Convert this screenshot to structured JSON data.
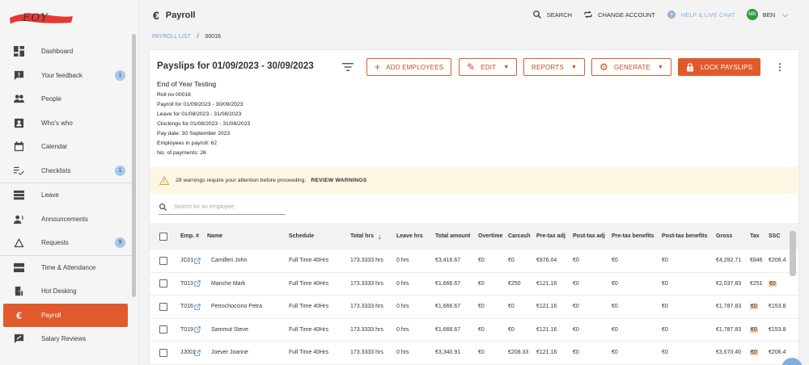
{
  "logo": {
    "text": "EOY"
  },
  "sidebar": {
    "items": [
      {
        "label": "Dashboard",
        "icon": "dashboard-icon"
      },
      {
        "label": "Your feedback",
        "icon": "feedback-icon",
        "badge": "1"
      },
      {
        "label": "People",
        "icon": "people-icon"
      },
      {
        "label": "Who's who",
        "icon": "contact-card-icon"
      },
      {
        "label": "Calendar",
        "icon": "calendar-icon"
      },
      {
        "label": "Checklists",
        "icon": "checklist-icon",
        "badge": "1"
      },
      {
        "label": "Leave",
        "icon": "leave-icon"
      },
      {
        "label": "Announcements",
        "icon": "announcement-icon"
      },
      {
        "label": "Requests",
        "icon": "requests-icon",
        "badge": "9"
      },
      {
        "label": "Time & Attendance",
        "icon": "clock-icon"
      },
      {
        "label": "Hot Desking",
        "icon": "desk-icon"
      },
      {
        "label": "Payroll",
        "icon": "euro-icon",
        "active": true
      },
      {
        "label": "Salary Reviews",
        "icon": "salary-review-icon"
      }
    ]
  },
  "header": {
    "title": "Payroll",
    "title_icon": "€",
    "search_label": "SEARCH",
    "change_account_label": "CHANGE ACCOUNT",
    "help_label": "HELP & LIVE CHAT",
    "user_initials": "MB",
    "user_name": "BEN"
  },
  "breadcrumb": {
    "link": "PAYROLL LIST",
    "separator": "/",
    "current": "00016"
  },
  "card": {
    "title": "Payslips for 01/09/2023 - 30/09/2023",
    "buttons": {
      "add_employees": "ADD EMPLOYEES",
      "edit": "EDIT",
      "reports": "REPORTS",
      "generate": "GENERATE",
      "lock_payslips": "LOCK PAYSLIPS"
    },
    "info": {
      "name": "End of Year Testing",
      "roll": "Roll no 00016",
      "payroll_for": "Payroll for 01/09/2023 - 30/09/2023",
      "leave_for": "Leave for 01/08/2023 - 31/08/2023",
      "clockings_for": "Clockings for 01/08/2023 - 31/08/2023",
      "pay_date": "Pay date: 30 September 2023",
      "employees": "Employees in payroll: 62",
      "payments": "No. of payments: 26"
    },
    "warning": {
      "text": "28 warnings require your attention before proceeding.",
      "action": "REVIEW WARNINGS",
      "color": "#fdf6e3"
    },
    "search_placeholder": "Search for an employee"
  },
  "table": {
    "headers": {
      "emp": "Emp. #",
      "name": "Name",
      "schedule": "Schedule",
      "total_hrs": "Total hrs",
      "leave_hrs": "Leave hrs",
      "total_amount": "Total amount",
      "overtime": "Overtime",
      "carcash": "Carcash",
      "pre_tax_adj": "Pre-tax adj",
      "post_tax_adj": "Post-tax adj",
      "pre_tax_benefits": "Pre-tax benefits",
      "post_tax_benefits": "Post-tax benefits",
      "gross": "Gross",
      "tax": "Tax",
      "ssc": "SSC"
    },
    "rows": [
      {
        "emp": "JC01",
        "name": "Camilleri John",
        "schedule": "Full Time 40Hrs",
        "total_hrs": "173.3333 hrs",
        "leave_hrs": "0 hrs",
        "total_amount": "€3,416.67",
        "overtime": "€0",
        "carcash": "€0",
        "pre_tax_adj": "€876.04",
        "post_tax_adj": "€0",
        "pre_tax_benefits": "€0",
        "post_tax_benefits": "€0",
        "gross": "€4,292.71",
        "tax": "€846",
        "tax_flag": false,
        "ssc": "€206.4",
        "ssc_flag": false
      },
      {
        "emp": "T013",
        "name": "Manche Mark",
        "schedule": "Full Time 40Hrs",
        "total_hrs": "173.3333 hrs",
        "leave_hrs": "0 hrs",
        "total_amount": "€1,666.67",
        "overtime": "€0",
        "carcash": "€250",
        "pre_tax_adj": "€121.16",
        "post_tax_adj": "€0",
        "pre_tax_benefits": "€0",
        "post_tax_benefits": "€0",
        "gross": "€2,037.83",
        "tax": "€251",
        "tax_flag": false,
        "ssc": "€0",
        "ssc_flag": true
      },
      {
        "emp": "T016",
        "name": "Petrochoccino Petra",
        "schedule": "Full Time 40Hrs",
        "total_hrs": "173.3333 hrs",
        "leave_hrs": "0 hrs",
        "total_amount": "€1,666.67",
        "overtime": "€0",
        "carcash": "€0",
        "pre_tax_adj": "€121.16",
        "post_tax_adj": "€0",
        "pre_tax_benefits": "€0",
        "post_tax_benefits": "€0",
        "gross": "€1,787.83",
        "tax": "€0",
        "tax_flag": true,
        "ssc": "€153.8",
        "ssc_flag": false
      },
      {
        "emp": "T019",
        "name": "Sammut Steve",
        "schedule": "Full Time 40Hrs",
        "total_hrs": "173.3333 hrs",
        "leave_hrs": "0 hrs",
        "total_amount": "€1,666.67",
        "overtime": "€0",
        "carcash": "€0",
        "pre_tax_adj": "€121.16",
        "post_tax_adj": "€0",
        "pre_tax_benefits": "€0",
        "post_tax_benefits": "€0",
        "gross": "€1,787.83",
        "tax": "€0",
        "tax_flag": true,
        "ssc": "€153.8",
        "ssc_flag": false
      },
      {
        "emp": "JJ001",
        "name": "Joever Joanne",
        "schedule": "Full Time 40Hrs",
        "total_hrs": "173.3333 hrs",
        "leave_hrs": "0 hrs",
        "total_amount": "€3,340.91",
        "overtime": "€0",
        "carcash": "€208.33",
        "pre_tax_adj": "€121.16",
        "post_tax_adj": "€0",
        "pre_tax_benefits": "€0",
        "post_tax_benefits": "€0",
        "gross": "€3,670.40",
        "tax": "€0",
        "tax_flag": true,
        "ssc": "€206.4",
        "ssc_flag": false
      }
    ]
  },
  "colors": {
    "accent": "#e15a2d",
    "badge": "#a7c8ea",
    "help": "#8fb2d6",
    "warning_bg": "#fdf6e3"
  }
}
